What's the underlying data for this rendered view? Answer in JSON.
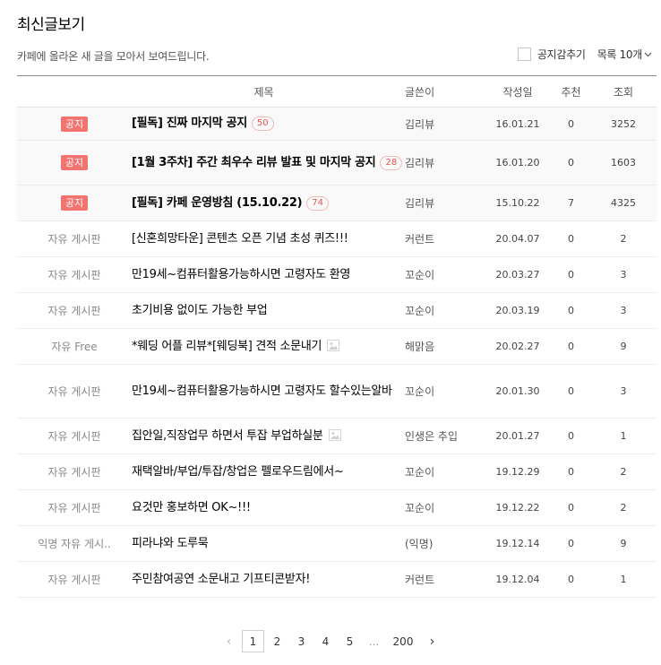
{
  "page": {
    "title": "최신글보기",
    "description": "카페에 올라온 새 글을 모아서 보여드립니다.",
    "hide_notice_label": "공지감추기",
    "list_size_label": "목록 10개"
  },
  "headers": {
    "title": "제목",
    "author": "글쓴이",
    "date": "작성일",
    "recommend": "추천",
    "views": "조회"
  },
  "rows": [
    {
      "category": "공지",
      "notice": true,
      "title": "[필독] 진짜 마지막 공지",
      "comments": "50",
      "author": "김리뷰",
      "date": "16.01.21",
      "recommend": "0",
      "views": "3252",
      "has_image": false
    },
    {
      "category": "공지",
      "notice": true,
      "title": "[1월 3주차] 주간 최우수 리뷰 발표 및 마지막 공지",
      "comments": "28",
      "author": "김리뷰",
      "date": "16.01.20",
      "recommend": "0",
      "views": "1603",
      "has_image": false
    },
    {
      "category": "공지",
      "notice": true,
      "title": "[필독] 카페 운영방침 (15.10.22)",
      "comments": "74",
      "author": "김리뷰",
      "date": "15.10.22",
      "recommend": "7",
      "views": "4325",
      "has_image": false
    },
    {
      "category": "자유 게시판",
      "notice": false,
      "title": "[신혼희망타운] 콘텐츠 오픈 기념 초성 퀴즈!!!",
      "comments": "",
      "author": "커런트",
      "date": "20.04.07",
      "recommend": "0",
      "views": "2",
      "has_image": false
    },
    {
      "category": "자유 게시판",
      "notice": false,
      "title": "만19세~컴퓨터활용가능하시면 고령자도 환영",
      "comments": "",
      "author": "꼬순이",
      "date": "20.03.27",
      "recommend": "0",
      "views": "3",
      "has_image": false
    },
    {
      "category": "자유 게시판",
      "notice": false,
      "title": "초기비용 없이도 가능한 부업",
      "comments": "",
      "author": "꼬순이",
      "date": "20.03.19",
      "recommend": "0",
      "views": "3",
      "has_image": false
    },
    {
      "category": "자유 Free",
      "notice": false,
      "title": "*웨딩 어플 리뷰*[웨딩북] 견적 소문내기",
      "comments": "",
      "author": "해맑음",
      "date": "20.02.27",
      "recommend": "0",
      "views": "9",
      "has_image": true
    },
    {
      "category": "자유 게시판",
      "notice": false,
      "title": "만19세~컴퓨터활용가능하시면 고령자도 할수있는알바",
      "comments": "",
      "author": "꼬순이",
      "date": "20.01.30",
      "recommend": "0",
      "views": "3",
      "has_image": false
    },
    {
      "category": "자유 게시판",
      "notice": false,
      "title": "집안일,직장업무 하면서 투잡 부업하실분",
      "comments": "",
      "author": "인생은 추입",
      "date": "20.01.27",
      "recommend": "0",
      "views": "1",
      "has_image": true
    },
    {
      "category": "자유 게시판",
      "notice": false,
      "title": "재택알바/부업/투잡/창업은 펠로우드림에서~",
      "comments": "",
      "author": "꼬순이",
      "date": "19.12.29",
      "recommend": "0",
      "views": "2",
      "has_image": false
    },
    {
      "category": "자유 게시판",
      "notice": false,
      "title": "요것만 홍보하면 OK~!!!",
      "comments": "",
      "author": "꼬순이",
      "date": "19.12.22",
      "recommend": "0",
      "views": "2",
      "has_image": false
    },
    {
      "category": "익명 자유 게시..",
      "notice": false,
      "title": "피라냐와 도루묵",
      "comments": "",
      "author": "(익명)",
      "date": "19.12.14",
      "recommend": "0",
      "views": "9",
      "has_image": false
    },
    {
      "category": "자유 게시판",
      "notice": false,
      "title": "주민참여공연 소문내고 기프티콘받자!",
      "comments": "",
      "author": "커런트",
      "date": "19.12.04",
      "recommend": "0",
      "views": "1",
      "has_image": false
    }
  ],
  "pagination": {
    "prev": "‹",
    "pages": [
      "1",
      "2",
      "3",
      "4",
      "5"
    ],
    "ellipsis": "...",
    "last": "200",
    "next": "›",
    "current": "1"
  }
}
